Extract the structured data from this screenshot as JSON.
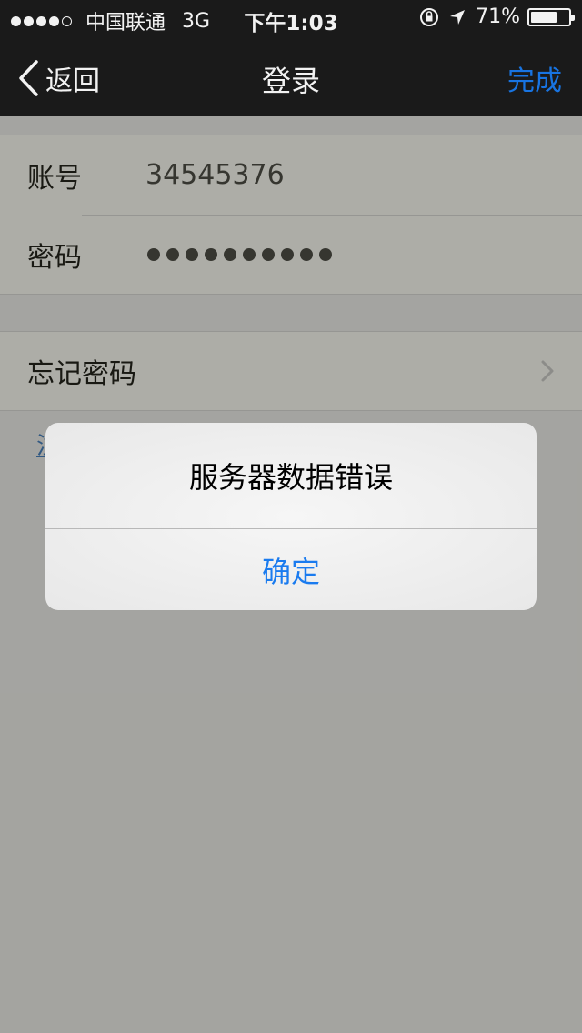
{
  "status_bar": {
    "carrier": "中国联通",
    "network": "3G",
    "time": "下午1:03",
    "battery_percent": "71%",
    "battery_level": 0.71
  },
  "nav": {
    "back_label": "返回",
    "title": "登录",
    "done_label": "完成"
  },
  "form": {
    "account_label": "账号",
    "account_value": "34545376",
    "password_label": "密码",
    "password_length": 10,
    "forgot_label": "忘记密码",
    "hint_text": "注"
  },
  "alert": {
    "message": "服务器数据错误",
    "confirm_label": "确定"
  },
  "colors": {
    "accent": "#1a7bef",
    "bar_background": "#1c1c1c"
  }
}
